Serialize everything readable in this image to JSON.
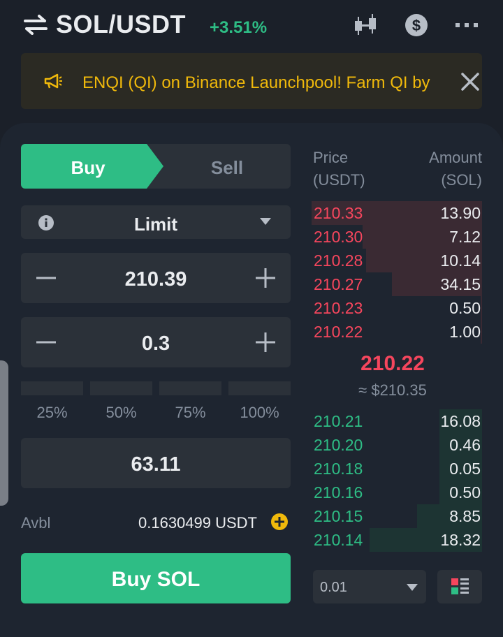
{
  "header": {
    "pair": "SOL/USDT",
    "change": "+3.51%",
    "icons": [
      "swap-icon",
      "candlestick-chart-icon",
      "dollar-circle-icon",
      "more-icon"
    ]
  },
  "banner": {
    "text": "ENQI (QI) on Binance Launchpool! Farm QI by",
    "icons": [
      "megaphone-icon",
      "close-icon"
    ]
  },
  "trade": {
    "buy_tab": "Buy",
    "sell_tab": "Sell",
    "order_type": "Limit",
    "price": "210.39",
    "amount": "0.3",
    "percents": [
      "25%",
      "50%",
      "75%",
      "100%"
    ],
    "total": "63.11",
    "avbl_label": "Avbl",
    "avbl_value": "0.1630499 USDT",
    "submit": "Buy SOL"
  },
  "orderbook": {
    "price_header_1": "Price",
    "price_header_2": "(USDT)",
    "amount_header_1": "Amount",
    "amount_header_2": "(SOL)",
    "asks": [
      {
        "price": "210.33",
        "amount": "13.90",
        "depth": 1.0
      },
      {
        "price": "210.30",
        "amount": "7.12",
        "depth": 0.7
      },
      {
        "price": "210.28",
        "amount": "10.14",
        "depth": 0.68
      },
      {
        "price": "210.27",
        "amount": "34.15",
        "depth": 0.53
      },
      {
        "price": "210.23",
        "amount": "0.50",
        "depth": 0.01
      },
      {
        "price": "210.22",
        "amount": "1.00",
        "depth": 0.01
      }
    ],
    "mid_price": "210.22",
    "mid_usd": "≈ $210.35",
    "bids": [
      {
        "price": "210.21",
        "amount": "16.08",
        "depth": 0.25
      },
      {
        "price": "210.20",
        "amount": "0.46",
        "depth": 0.25
      },
      {
        "price": "210.18",
        "amount": "0.05",
        "depth": 0.25
      },
      {
        "price": "210.16",
        "amount": "0.50",
        "depth": 0.25
      },
      {
        "price": "210.15",
        "amount": "8.85",
        "depth": 0.38
      },
      {
        "price": "210.14",
        "amount": "18.32",
        "depth": 0.66
      }
    ],
    "precision": "0.01"
  },
  "colors": {
    "background": "#1b2029",
    "panel": "#1e2530",
    "buy_green": "#2ebd85",
    "sell_red": "#f6465d",
    "accent_yellow": "#f0b90b",
    "muted": "#848e9c"
  }
}
